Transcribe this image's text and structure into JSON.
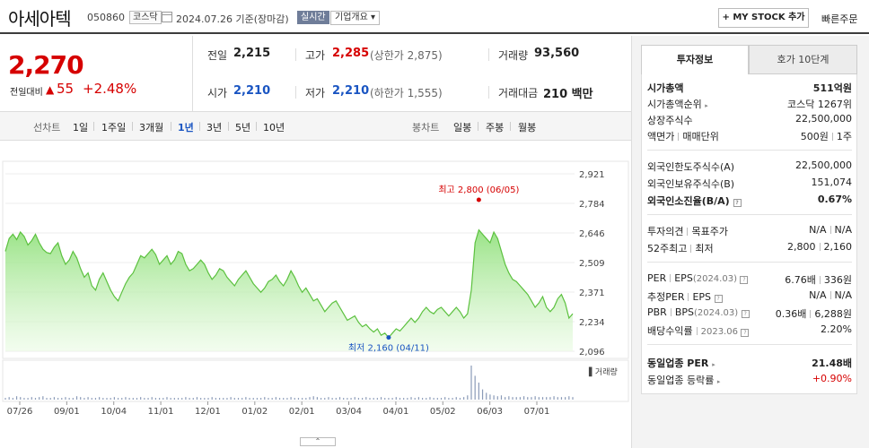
{
  "header": {
    "name": "아세아텍",
    "code": "050860",
    "market": "코스닥",
    "date": "2024.07.26  기준(장마감)",
    "realtime": "실시간",
    "company_info": "기업개요 ▾",
    "mystock_label": "+ MY STOCK 추가",
    "quick_order_label": "빠른주문"
  },
  "price": {
    "current": "2,270",
    "change_label": "전일대비",
    "change_arrow": "▲",
    "change_value": "55",
    "change_rate": "+2.48%"
  },
  "quote": {
    "prev_close": {
      "label": "전일",
      "value": "2,215"
    },
    "high": {
      "label": "고가",
      "value": "2,285",
      "sub": "(상한가 2,875)"
    },
    "volume": {
      "label": "거래량",
      "value": "93,560"
    },
    "open": {
      "label": "시가",
      "value": "2,210"
    },
    "low": {
      "label": "저가",
      "value": "2,210",
      "sub": "(하한가 1,555)"
    },
    "amount": {
      "label": "거래대금",
      "value": "210 백만"
    }
  },
  "periods": {
    "line_label": "선차트",
    "line_items": [
      "1일",
      "1주일",
      "3개월",
      "1년",
      "3년",
      "5년",
      "10년"
    ],
    "active": "1년",
    "candle_label": "봉차트",
    "candle_items": [
      "일봉",
      "주봉",
      "월봉"
    ]
  },
  "chart_data": {
    "type": "area",
    "yticks": [
      "2,921",
      "2,784",
      "2,646",
      "2,509",
      "2,371",
      "2,234",
      "2,096"
    ],
    "ylim": [
      2096,
      2921
    ],
    "xticks": [
      "07/26",
      "09/01",
      "10/04",
      "11/01",
      "12/01",
      "01/02",
      "02/01",
      "03/04",
      "04/01",
      "05/02",
      "06/03",
      "07/01"
    ],
    "high_label": "최고 2,800 (06/05)",
    "low_label": "최저 2,160 (04/11)",
    "high_value": 2800,
    "low_value": 2160,
    "volume_label": "거래량",
    "prices": [
      2560,
      2620,
      2640,
      2615,
      2650,
      2630,
      2590,
      2610,
      2640,
      2600,
      2570,
      2555,
      2550,
      2580,
      2600,
      2540,
      2500,
      2520,
      2560,
      2530,
      2480,
      2440,
      2460,
      2400,
      2380,
      2430,
      2460,
      2420,
      2380,
      2350,
      2330,
      2370,
      2410,
      2440,
      2460,
      2500,
      2540,
      2530,
      2550,
      2570,
      2545,
      2500,
      2520,
      2540,
      2500,
      2520,
      2560,
      2550,
      2500,
      2470,
      2480,
      2500,
      2520,
      2500,
      2460,
      2430,
      2450,
      2480,
      2470,
      2440,
      2420,
      2400,
      2430,
      2450,
      2470,
      2440,
      2410,
      2390,
      2370,
      2390,
      2420,
      2430,
      2450,
      2420,
      2400,
      2430,
      2470,
      2440,
      2400,
      2370,
      2390,
      2360,
      2330,
      2340,
      2310,
      2280,
      2300,
      2320,
      2330,
      2300,
      2270,
      2240,
      2250,
      2260,
      2230,
      2210,
      2220,
      2200,
      2185,
      2200,
      2170,
      2180,
      2160,
      2180,
      2200,
      2190,
      2210,
      2230,
      2250,
      2230,
      2250,
      2280,
      2300,
      2280,
      2270,
      2290,
      2300,
      2280,
      2260,
      2280,
      2300,
      2280,
      2250,
      2270,
      2380,
      2600,
      2660,
      2640,
      2620,
      2600,
      2650,
      2620,
      2560,
      2500,
      2460,
      2430,
      2420,
      2400,
      2380,
      2360,
      2330,
      2300,
      2320,
      2350,
      2300,
      2280,
      2300,
      2340,
      2360,
      2320,
      2250,
      2270
    ],
    "volumes": [
      2,
      3,
      2,
      4,
      3,
      2,
      2,
      3,
      2,
      3,
      4,
      2,
      2,
      3,
      2,
      2,
      3,
      2,
      2,
      4,
      3,
      2,
      3,
      2,
      2,
      3,
      2,
      2,
      2,
      3,
      2,
      2,
      3,
      2,
      2,
      2,
      3,
      2,
      2,
      3,
      2,
      2,
      2,
      3,
      2,
      2,
      2,
      2,
      3,
      2,
      2,
      3,
      2,
      2,
      2,
      3,
      2,
      2,
      2,
      2,
      3,
      2,
      2,
      2,
      3,
      2,
      2,
      2,
      2,
      3,
      2,
      2,
      3,
      2,
      2,
      2,
      3,
      2,
      2,
      2,
      2,
      3,
      4,
      3,
      2,
      2,
      3,
      2,
      2,
      3,
      2,
      2,
      2,
      3,
      2,
      2,
      3,
      2,
      2,
      2,
      3,
      2,
      2,
      2,
      3,
      2,
      2,
      2,
      3,
      2,
      3,
      2,
      2,
      3,
      2,
      2,
      2,
      3,
      2,
      2,
      3,
      2,
      3,
      5,
      40,
      28,
      20,
      12,
      8,
      6,
      5,
      4,
      5,
      3,
      4,
      3,
      3,
      3,
      4,
      3,
      3,
      4,
      3,
      3,
      3,
      3,
      4,
      3,
      3,
      3,
      4,
      3
    ]
  },
  "right": {
    "tab_invest": "투자정보",
    "tab_orderbook": "호가 10단계",
    "rows": {
      "market_cap": {
        "label": "시가총액",
        "value": "511억원"
      },
      "market_cap_rank": {
        "label": "시가총액순위",
        "value": "코스닥 1267위"
      },
      "listed_shares": {
        "label": "상장주식수",
        "value": "22,500,000"
      },
      "face_value_label": "액면가",
      "unit_label": "매매단위",
      "face_value": "500원",
      "unit": "1주",
      "foreign_limit": {
        "label": "외국인한도주식수(A)",
        "value": "22,500,000"
      },
      "foreign_holding": {
        "label": "외국인보유주식수(B)",
        "value": "151,074"
      },
      "foreign_ratio": {
        "label": "외국인소진율(B/A)",
        "value": "0.67%"
      },
      "opinion_label": "투자의견",
      "target_label": "목표주가",
      "opinion": "N/A",
      "target": "N/A",
      "w52_label": "52주최고",
      "w52_low_label": "최저",
      "w52_high": "2,800",
      "w52_low": "2,160",
      "per_label": "PER",
      "eps_label": "EPS",
      "per_period": "(2024.03)",
      "per": "6.76배",
      "eps": "336원",
      "est_per_label": "추정PER",
      "est_eps_label": "EPS",
      "est_per": "N/A",
      "est_eps": "N/A",
      "pbr_label": "PBR",
      "bps_label": "BPS",
      "pbr_period": "(2024.03)",
      "pbr": "0.36배",
      "bps": "6,288원",
      "dividend_label": "배당수익률",
      "dividend_period": "2023.06",
      "dividend": "2.20%",
      "sector_per": {
        "label": "동일업종 PER",
        "value": "21.48배"
      },
      "sector_change": {
        "label": "동일업종 등락률",
        "value": "+0.90%"
      }
    }
  }
}
